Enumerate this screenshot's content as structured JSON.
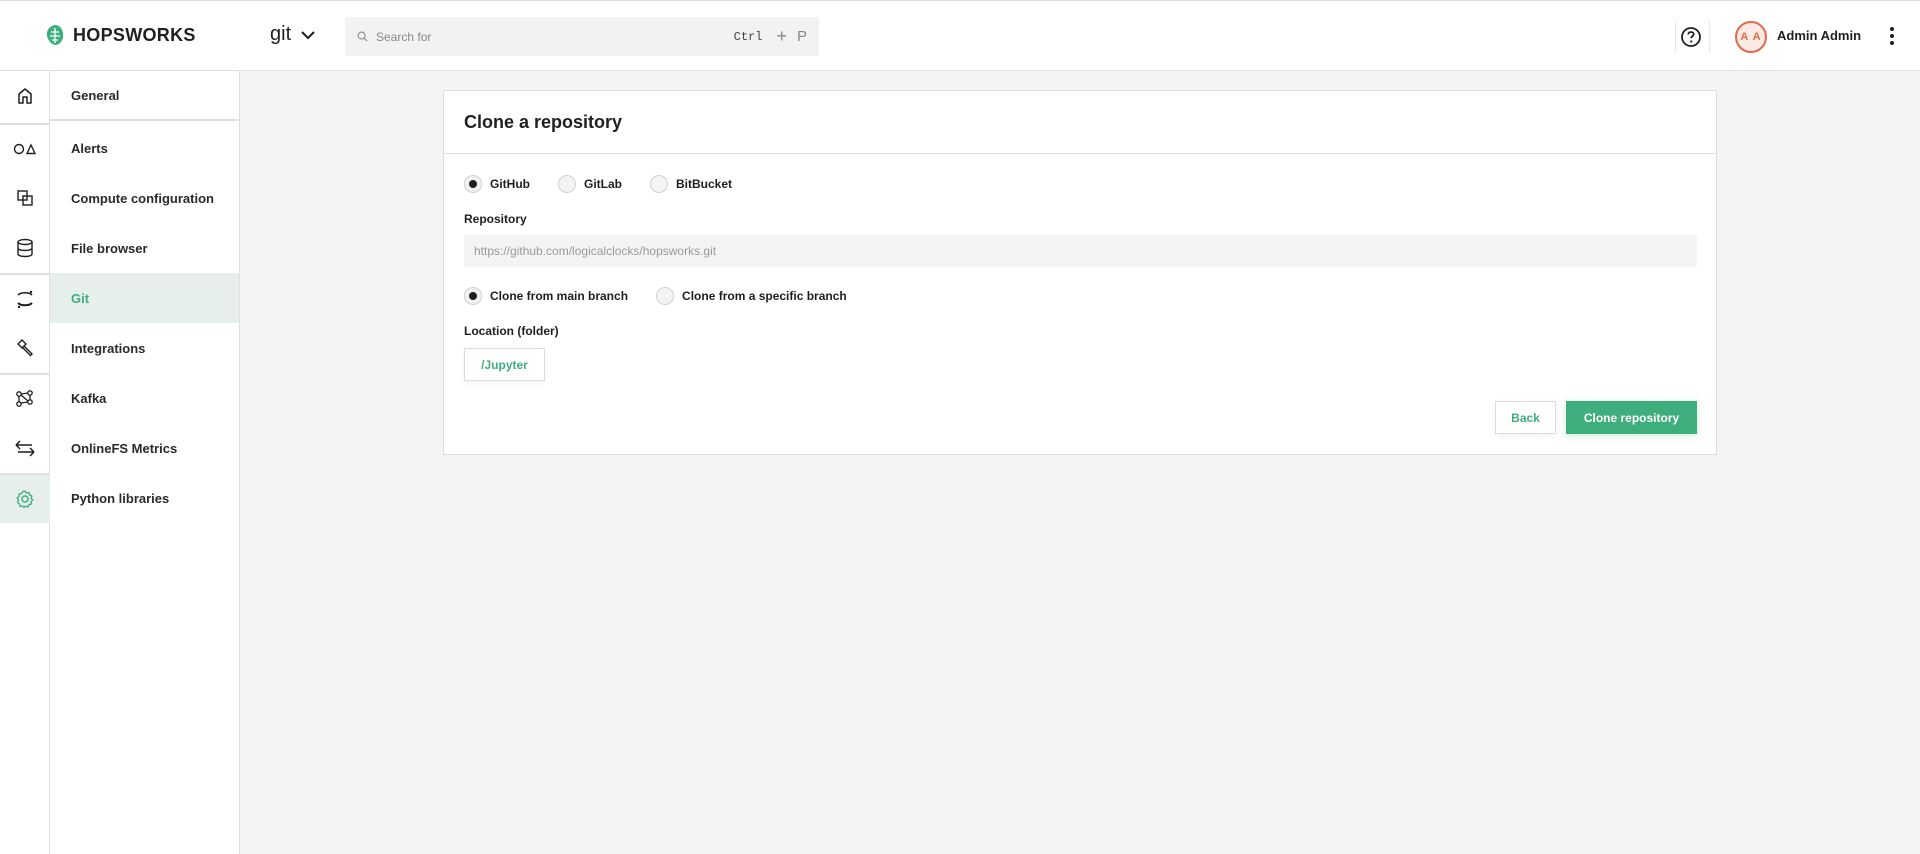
{
  "header": {
    "brand": "HOPSWORKS",
    "project": "git",
    "search": {
      "placeholder": "Search for",
      "shortcut_key1": "Ctrl",
      "shortcut_plus": "+",
      "shortcut_key2": "P"
    },
    "user": {
      "initials": "A A",
      "name": "Admin Admin"
    },
    "brand_color": "#3eaf7c",
    "avatar_color": "#e06a4c"
  },
  "icon_sidebar": [
    {
      "icon": "home-icon"
    },
    {
      "icon": "alerts-shapes-icon"
    },
    {
      "icon": "compute-copy-icon"
    },
    {
      "icon": "database-icon"
    },
    {
      "icon": "git-icon"
    },
    {
      "icon": "hammer-icon"
    },
    {
      "icon": "kafka-network-icon"
    },
    {
      "icon": "transfer-arrows-icon"
    },
    {
      "icon": "settings-gear-icon",
      "active": true
    }
  ],
  "menu": {
    "items": [
      {
        "label": "General"
      },
      {
        "label": "Alerts"
      },
      {
        "label": "Compute configuration"
      },
      {
        "label": "File browser"
      },
      {
        "label": "Git",
        "active": true
      },
      {
        "label": "Integrations"
      },
      {
        "label": "Kafka"
      },
      {
        "label": "OnlineFS Metrics"
      },
      {
        "label": "Python libraries"
      }
    ]
  },
  "form": {
    "title": "Clone a repository",
    "providers": [
      {
        "label": "GitHub",
        "selected": true
      },
      {
        "label": "GitLab",
        "selected": false
      },
      {
        "label": "BitBucket",
        "selected": false
      }
    ],
    "repository_label": "Repository",
    "repository_value": "",
    "repository_placeholder": "https://github.com/logicalclocks/hopsworks.git",
    "branch_options": [
      {
        "label": "Clone from main branch",
        "selected": true
      },
      {
        "label": "Clone from a specific branch",
        "selected": false
      }
    ],
    "location_label": "Location (folder)",
    "location_value": "/Jupyter",
    "back_label": "Back",
    "submit_label": "Clone repository"
  }
}
